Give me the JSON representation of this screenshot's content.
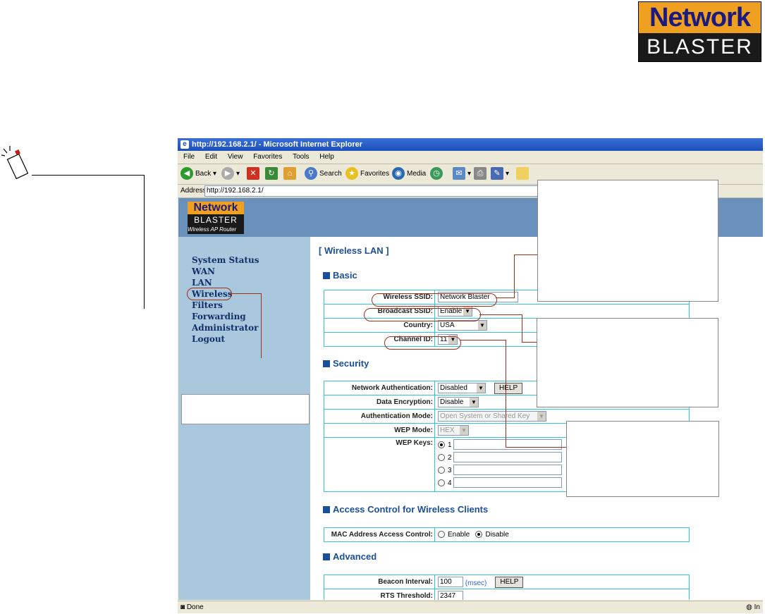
{
  "brand": {
    "line1": "Network",
    "line2": "BLASTER"
  },
  "browser": {
    "title": "http://192.168.2.1/ - Microsoft Internet Explorer",
    "menu": [
      "File",
      "Edit",
      "View",
      "Favorites",
      "Tools",
      "Help"
    ],
    "toolbar": {
      "back": "Back",
      "search": "Search",
      "favorites": "Favorites",
      "media": "Media"
    },
    "address_label": "Address",
    "address_value": "http://192.168.2.1/",
    "status": "Done",
    "status_zone": "In"
  },
  "router_logo": {
    "line1": "Network",
    "line2": "BLASTER",
    "line3": "Wireless AP Router"
  },
  "nav": [
    "System Status",
    "WAN",
    "LAN",
    "Wireless",
    "Filters",
    "Forwarding",
    "Administrator",
    "Logout"
  ],
  "page_title": "[ Wireless LAN ]",
  "basic": {
    "heading": "Basic",
    "ssid_label": "Wireless SSID:",
    "ssid_value": "Network Blaster",
    "broadcast_label": "Broadcast SSID:",
    "broadcast_value": "Enable",
    "country_label": "Country:",
    "country_value": "USA",
    "channel_label": "Channel ID:",
    "channel_value": "11"
  },
  "security": {
    "heading": "Security",
    "auth_label": "Network Authentication:",
    "auth_value": "Disabled",
    "help": "HELP",
    "enc_label": "Data Encryption:",
    "enc_value": "Disable",
    "mode_label": "Authentication Mode:",
    "mode_value": "Open System or Shared Key",
    "wep_mode_label": "WEP Mode:",
    "wep_mode_value": "HEX",
    "wep_keys_label": "WEP Keys:",
    "keys": [
      "1",
      "2",
      "3",
      "4"
    ]
  },
  "access": {
    "heading": "Access Control for Wireless Clients",
    "mac_label": "MAC Address Access Control:",
    "enable": "Enable",
    "disable": "Disable"
  },
  "advanced": {
    "heading": "Advanced",
    "beacon_label": "Beacon Interval:",
    "beacon_value": "100",
    "beacon_unit": "(msec)",
    "help": "HELP",
    "rts_label": "RTS Threshold:",
    "rts_value": "2347"
  }
}
